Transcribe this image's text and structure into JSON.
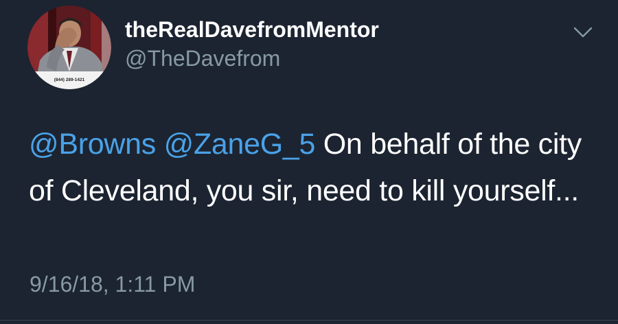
{
  "user": {
    "display_name": "theRealDavefromMentor",
    "handle": "@TheDavefrom",
    "avatar_caption": "(844) 289-1421"
  },
  "tweet": {
    "mention_1": "@Browns",
    "mention_2": "@ZaneG_5",
    "body": " On behalf of the city of Cleveland, you sir, need to kill yourself...",
    "timestamp": "9/16/18, 1:11 PM"
  },
  "icons": {
    "menu": "chevron-down-icon",
    "avatar": "avatar"
  },
  "colors": {
    "background": "#1c2431",
    "link": "#4aa2e8",
    "secondary_text": "#8899a6",
    "primary_text": "#ffffff"
  }
}
